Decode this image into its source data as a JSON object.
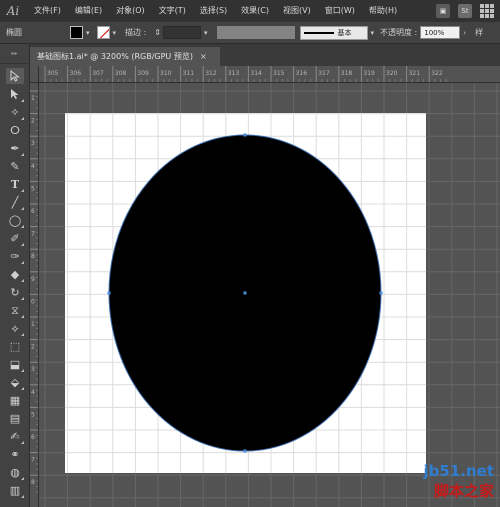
{
  "app": {
    "logo": "Ai"
  },
  "menu": [
    "文件(F)",
    "编辑(E)",
    "对象(O)",
    "文字(T)",
    "选择(S)",
    "效果(C)",
    "视图(V)",
    "窗口(W)",
    "帮助(H)"
  ],
  "menu_right": {
    "stock_badge": "St"
  },
  "control_bar": {
    "selection_label": "椭圆",
    "stroke_label": "描边 :",
    "brush_label": "基本",
    "opacity_label": "不透明度 :",
    "opacity_value": "100%",
    "style_label": "样",
    "fill_color": "#000000"
  },
  "document_tab": {
    "title": "基础图标1.ai* @ 3200% (RGB/GPU 预览)",
    "close": "×"
  },
  "rulers": {
    "top": [
      "305",
      "306",
      "307",
      "308",
      "309",
      "310",
      "311",
      "312",
      "313",
      "314",
      "315",
      "316",
      "317",
      "318",
      "319",
      "320",
      "321",
      "322"
    ],
    "left": [
      "1",
      "2",
      "3",
      "4",
      "5",
      "6",
      "7",
      "8",
      "9",
      "0",
      "1",
      "2",
      "3",
      "4",
      "5",
      "6",
      "7",
      "8"
    ]
  },
  "canvas": {
    "shape": "ellipse",
    "fill": "#000000",
    "anchor_color": "#4a90d9"
  },
  "watermark": {
    "url": "jb51.net",
    "name": "脚本之家"
  }
}
